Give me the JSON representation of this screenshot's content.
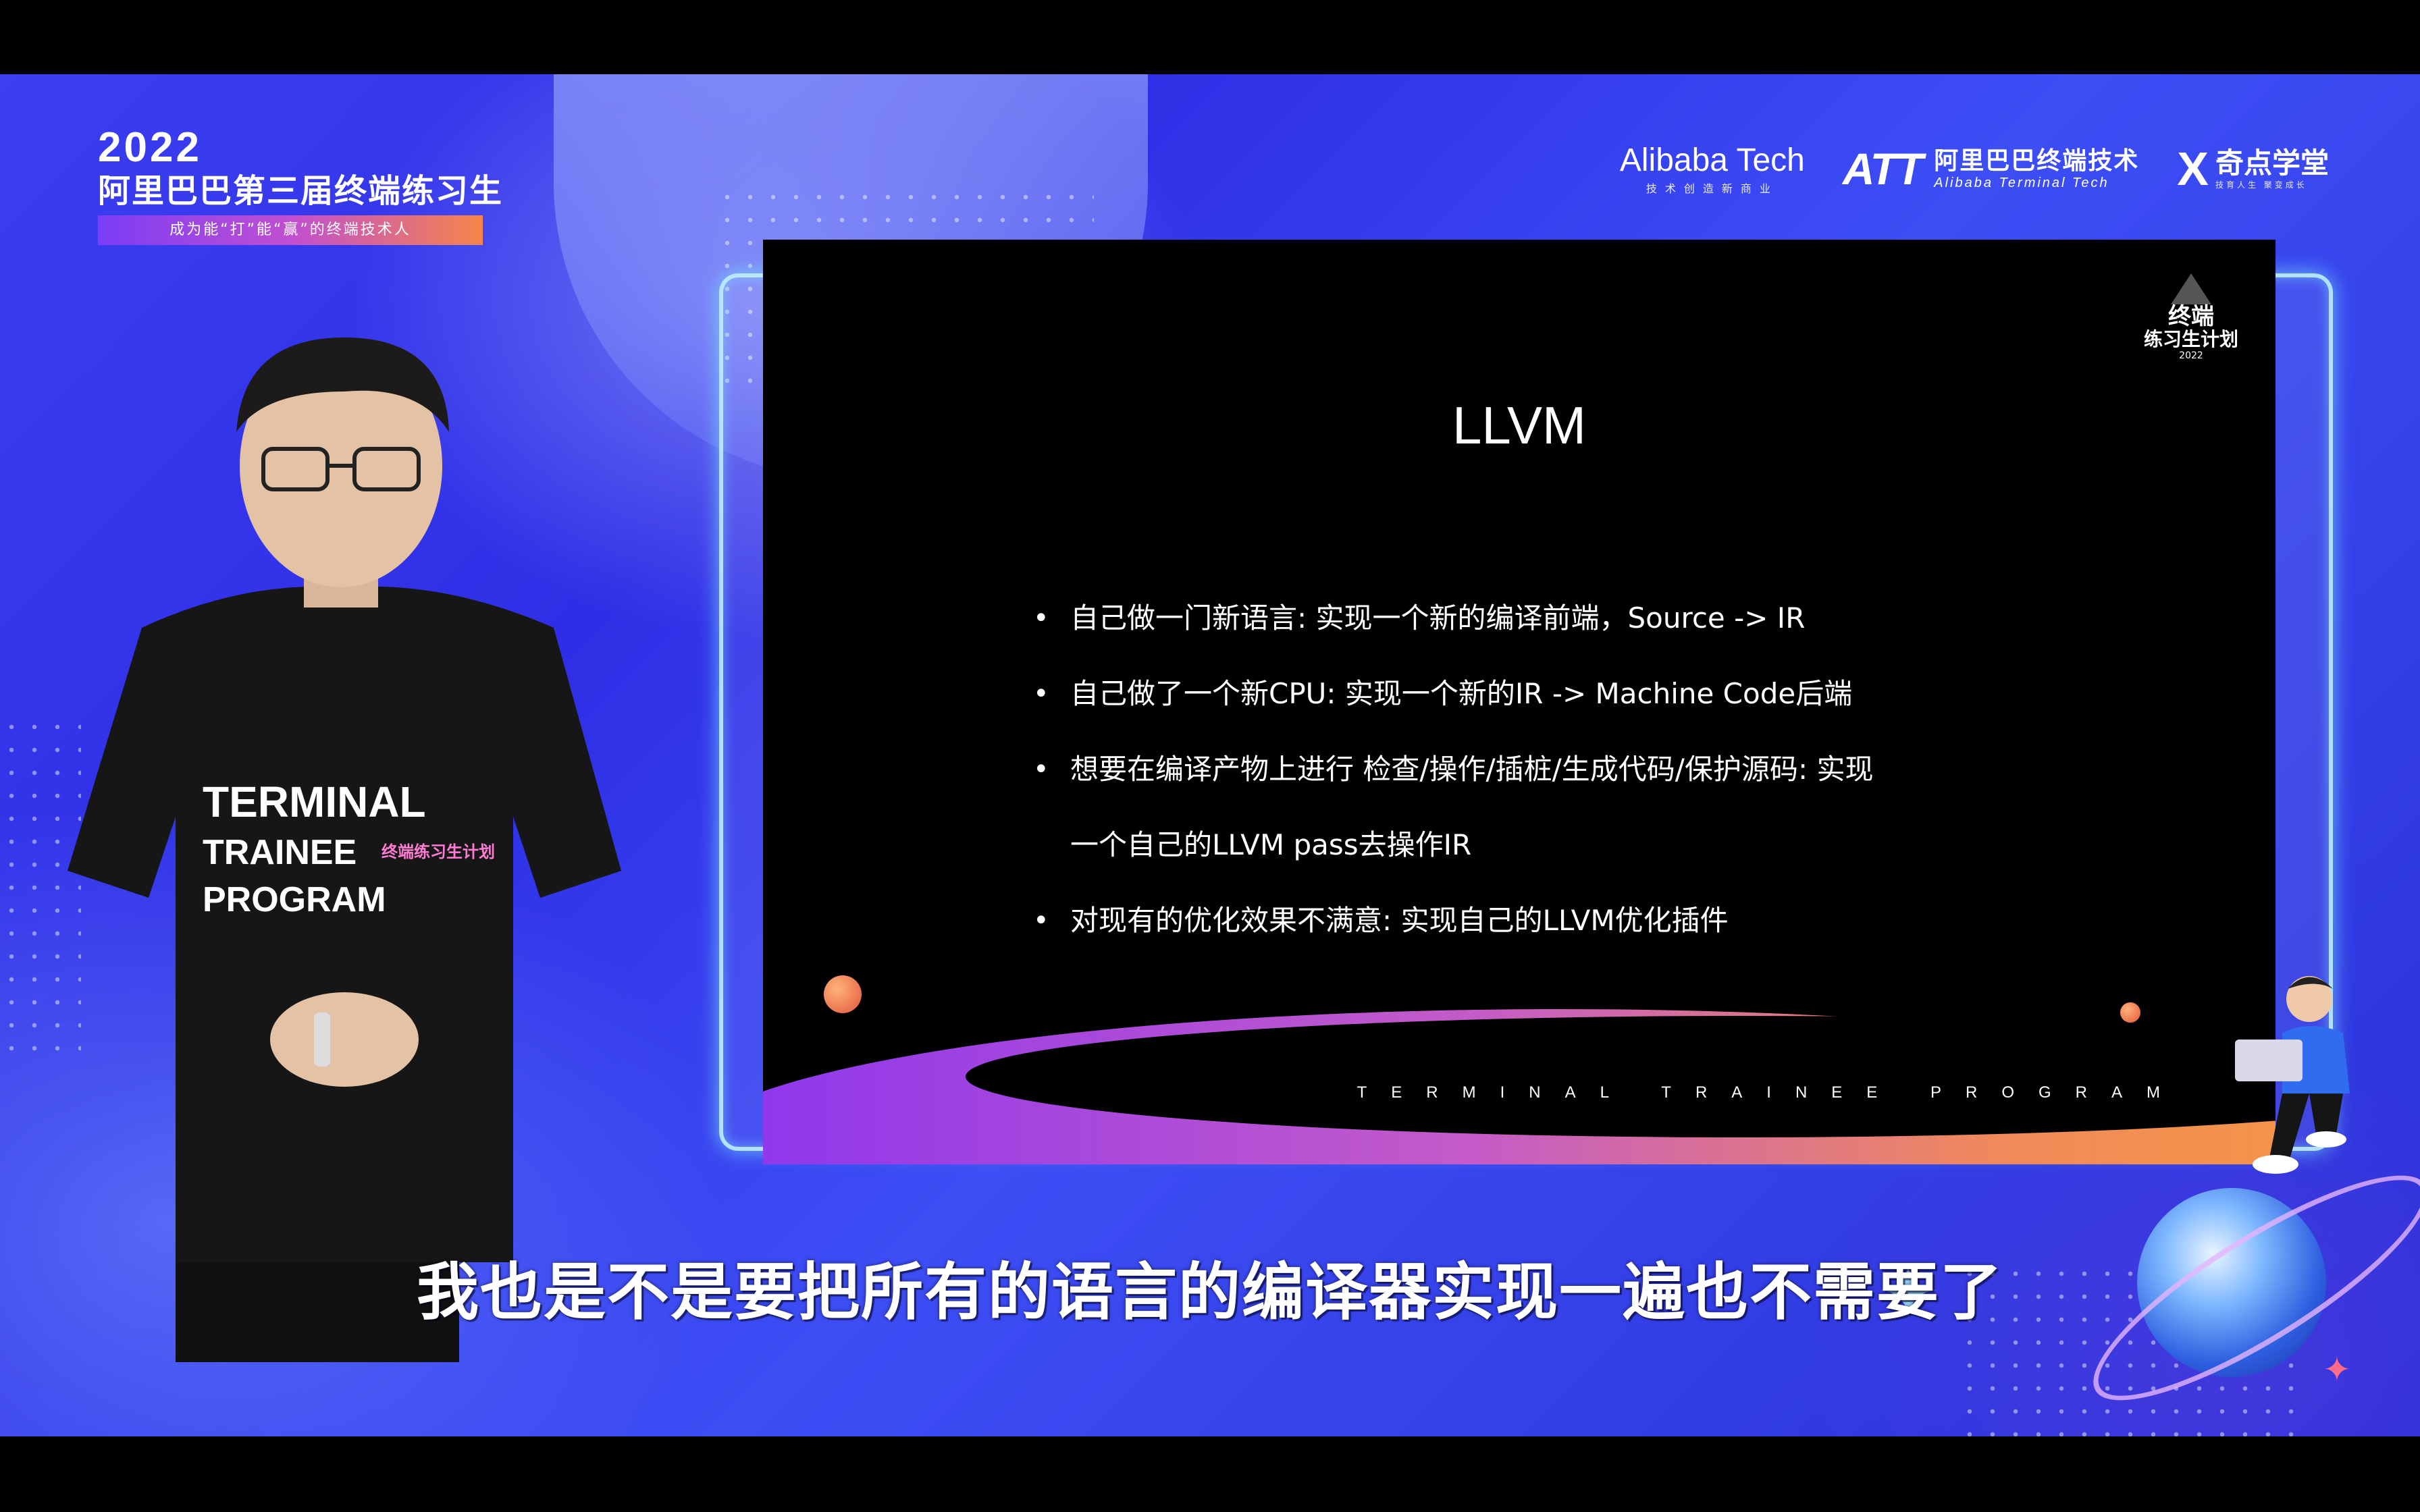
{
  "event": {
    "year": "2022",
    "name": "阿里巴巴第三届终端练习生",
    "slogan": "成为能“打”能“赢”的终端技术人"
  },
  "sponsors": {
    "alibaba_tech": {
      "name": "Alibaba Tech",
      "tagline": "技术创造新商业"
    },
    "att": {
      "mark": "ATT",
      "cn": "阿里巴巴终端技术",
      "en": "Alibaba Terminal Tech"
    },
    "qidian": {
      "mark": "X",
      "cn": "奇点学堂",
      "tagline": "技育人生 聚变成长"
    }
  },
  "slide": {
    "badge": {
      "line1": "终端",
      "line2": "练习生计划",
      "line3": "2022"
    },
    "title": "LLVM",
    "bullets": [
      {
        "text": "自己做一门新语言: 实现一个新的编译前端，Source -> IR"
      },
      {
        "text": "自己做了一个新CPU: 实现一个新的IR -> Machine Code后端"
      },
      {
        "text": "想要在编译产物上进行 检查/操作/插桩/生成代码/保护源码: 实现",
        "cont": "一个自己的LLVM pass去操作IR"
      },
      {
        "text": "对现有的优化效果不满意: 实现自己的LLVM优化插件"
      }
    ],
    "program_label": "TERMINAL TRAINEE PROGRAM"
  },
  "presenter": {
    "shirt_line1": "TERMINAL",
    "shirt_line2": "TRAINEE",
    "shirt_line3": "PROGRAM",
    "shirt_badge": "终端练习生计划"
  },
  "subtitle": "我也是不是要把所有的语言的编译器实现一遍也不需要了",
  "colors": {
    "background": "#3b3ff0",
    "slide_bg": "#000000",
    "accent_orange": "#f5854a",
    "accent_purple": "#7b3df6",
    "frame_glow": "#78dcff"
  }
}
